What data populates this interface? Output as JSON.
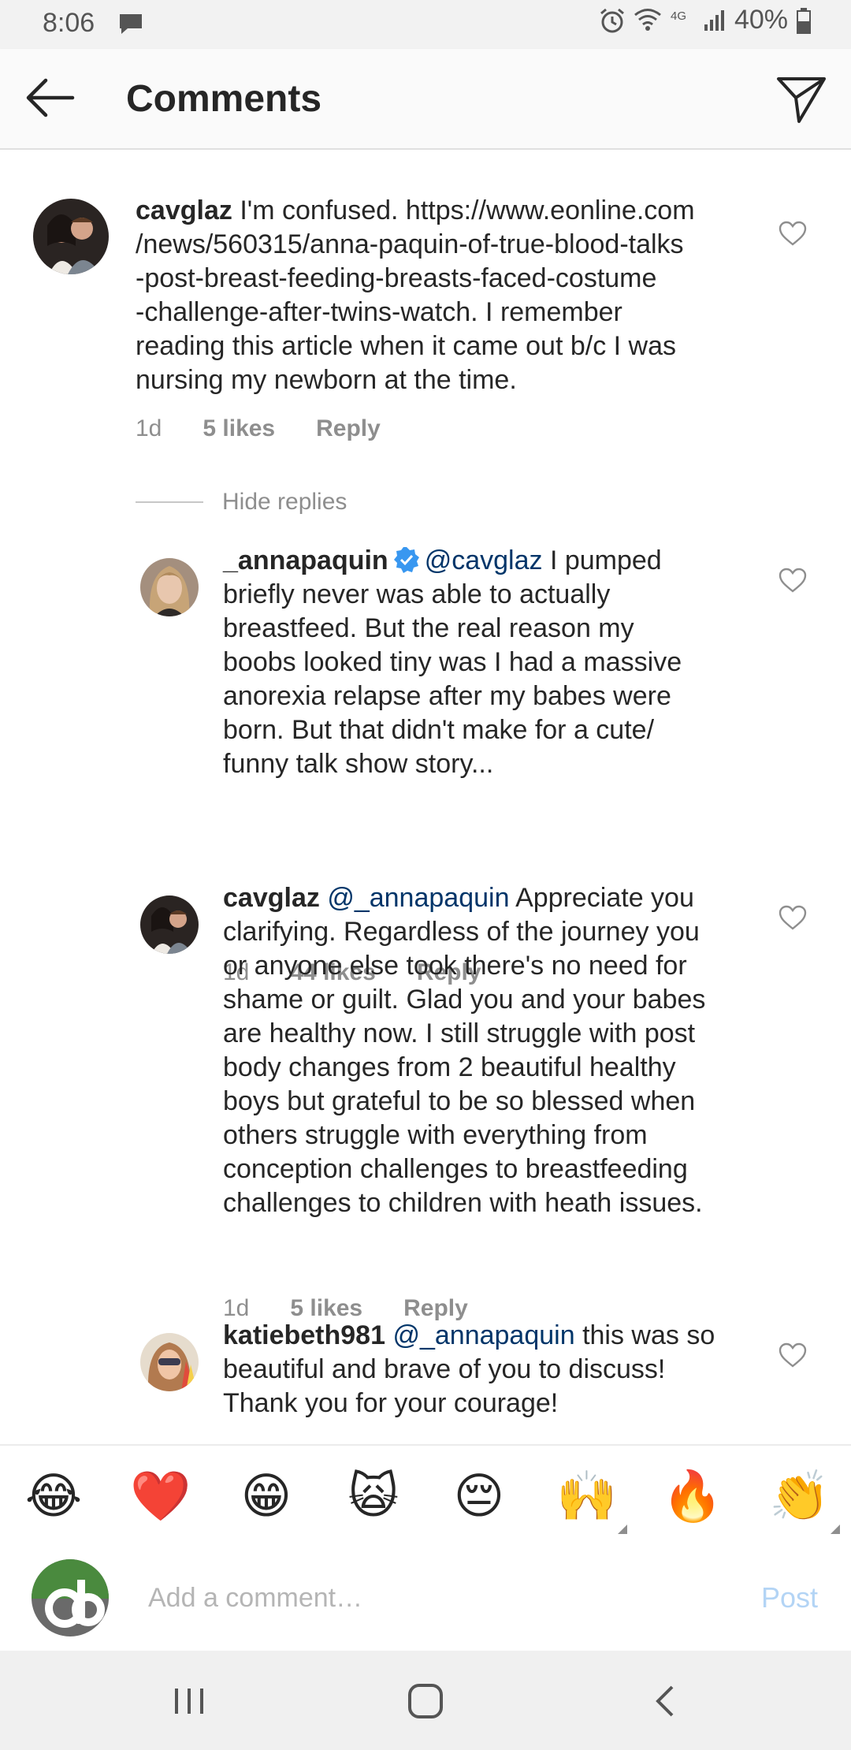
{
  "status_bar": {
    "time": "8:06",
    "battery": "40%",
    "icons": [
      "message-icon",
      "alarm-icon",
      "wifi-icon",
      "4g-icon",
      "signal-icon",
      "battery-icon"
    ]
  },
  "header": {
    "title": "Comments",
    "back_icon": "arrow-left-icon",
    "share_icon": "paper-plane-icon"
  },
  "comments": [
    {
      "username": "cavglaz",
      "lines": [
        "I'm confused. https://www.eonline.com",
        "/news/560315/anna-paquin-of-true-blood-talks",
        "-post-breast-feeding-breasts-faced-costume",
        "-challenge-after-twins-watch. I remember",
        "reading this article when it came out b/c I was",
        "nursing my newborn at the time."
      ],
      "time": "1d",
      "likes": "5 likes",
      "reply": "Reply"
    },
    {
      "username": "_annapaquin",
      "verified": true,
      "mention": "@cavglaz",
      "lines": [
        "I pumped",
        "briefly never was able to actually",
        "breastfeed. But the real reason my",
        "boobs looked tiny was I had a massive",
        "anorexia relapse after my babes were",
        "born.  But that didn't make for a cute/",
        "funny talk show story..."
      ],
      "time": "1d",
      "likes": "44 likes",
      "reply": "Reply"
    },
    {
      "username": "cavglaz",
      "mention": "@_annapaquin",
      "lines": [
        "Appreciate you",
        "clarifying. Regardless of the journey you",
        "or anyone else took there's no need for",
        "shame or guilt. Glad you and your babes",
        "are healthy now.  I still struggle with post",
        "body changes from 2 beautiful healthy",
        "boys but grateful to be so blessed when",
        "others struggle with everything from",
        "conception challenges to breastfeeding",
        "challenges to children with heath issues."
      ],
      "time": "1d",
      "likes": "5 likes",
      "reply": "Reply"
    },
    {
      "username": "katiebeth981",
      "mention": "@_annapaquin",
      "lines": [
        "this was so",
        "beautiful and brave of you to discuss!",
        "Thank you for your courage!"
      ]
    }
  ],
  "hide_replies": "Hide replies",
  "emojis": [
    "😂",
    "❤️",
    "😁",
    "🙀",
    "😔",
    "🙌",
    "🔥",
    "👏"
  ],
  "composer": {
    "placeholder": "Add a comment…",
    "post_label": "Post"
  },
  "colors": {
    "mention": "#003569",
    "meta": "#8e8e8e",
    "post_disabled": "#b3d4f5",
    "verified": "#3897f0"
  }
}
